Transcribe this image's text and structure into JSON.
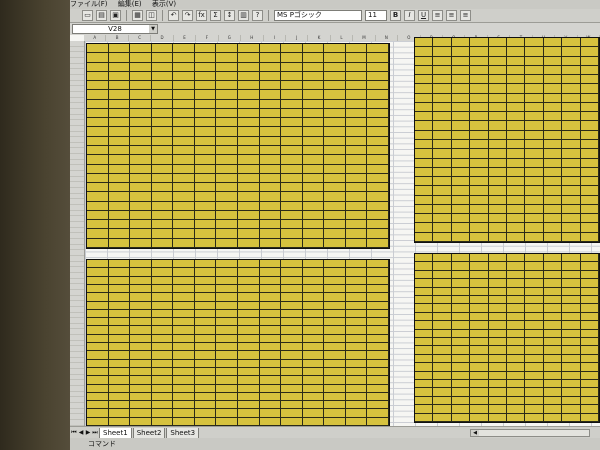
{
  "menubar": {
    "items": [
      "ファイル(F)",
      "編集(E)",
      "表示(V)"
    ]
  },
  "toolbar": {
    "buttons": [
      "new-icon",
      "open-icon",
      "save-icon",
      "print-icon",
      "preview-icon",
      "undo-icon",
      "redo-icon",
      "function-icon",
      "sum-icon",
      "sort-icon",
      "chart-icon",
      "help-icon"
    ],
    "sum_label": "Σ",
    "function_label": "fx",
    "font_name": "MS Pゴシック",
    "font_size": "11",
    "bold_label": "B",
    "italic_label": "I",
    "underline_label": "U"
  },
  "formula_bar": {
    "name_box": "V28"
  },
  "grid": {
    "columns": [
      "A",
      "B",
      "C",
      "D",
      "E",
      "F",
      "G",
      "H",
      "I",
      "J",
      "K",
      "L",
      "M",
      "N",
      "O",
      "P",
      "Q",
      "R",
      "S",
      "T",
      "U",
      "V",
      "W"
    ]
  },
  "sheet_tabs": [
    "Sheet1",
    "Sheet2",
    "Sheet3"
  ],
  "status": {
    "text": "コマンド"
  },
  "colors": {
    "cell_fill": "#d6c23e",
    "cell_text": "#c4421a",
    "grid_line": "#c9ccd2"
  }
}
